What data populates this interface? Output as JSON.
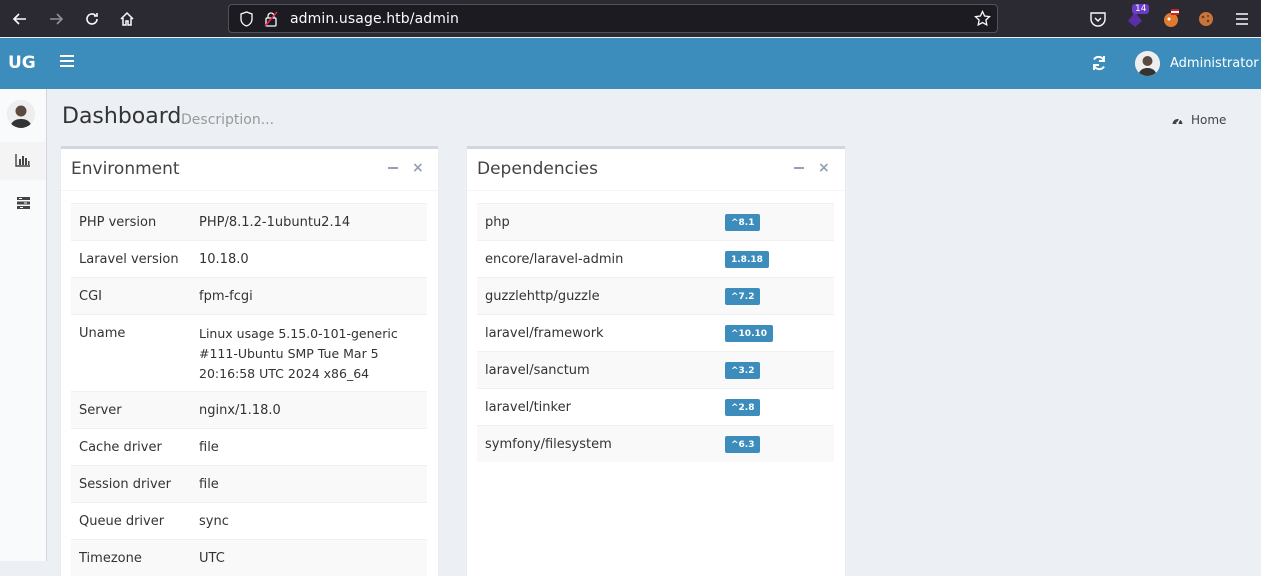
{
  "browser": {
    "url": "admin.usage.htb/admin",
    "notification_count": "14"
  },
  "header": {
    "logo": "UG",
    "user_name": "Administrator"
  },
  "content": {
    "title": "Dashboard",
    "description": "Description...",
    "breadcrumb_home": "Home"
  },
  "environment": {
    "title": "Environment",
    "rows": [
      {
        "key": "PHP version",
        "value": "PHP/8.1.2-1ubuntu2.14"
      },
      {
        "key": "Laravel version",
        "value": "10.18.0"
      },
      {
        "key": "CGI",
        "value": "fpm-fcgi"
      },
      {
        "key": "Uname",
        "value": "Linux usage 5.15.0-101-generic #111-Ubuntu SMP Tue Mar 5 20:16:58 UTC 2024 x86_64"
      },
      {
        "key": "Server",
        "value": "nginx/1.18.0"
      },
      {
        "key": "Cache driver",
        "value": "file"
      },
      {
        "key": "Session driver",
        "value": "file"
      },
      {
        "key": "Queue driver",
        "value": "sync"
      },
      {
        "key": "Timezone",
        "value": "UTC"
      }
    ]
  },
  "dependencies": {
    "title": "Dependencies",
    "rows": [
      {
        "name": "php",
        "version": "^8.1"
      },
      {
        "name": "encore/laravel-admin",
        "version": "1.8.18"
      },
      {
        "name": "guzzlehttp/guzzle",
        "version": "^7.2"
      },
      {
        "name": "laravel/framework",
        "version": "^10.10"
      },
      {
        "name": "laravel/sanctum",
        "version": "^3.2"
      },
      {
        "name": "laravel/tinker",
        "version": "^2.8"
      },
      {
        "name": "symfony/filesystem",
        "version": "^6.3"
      }
    ]
  },
  "colors": {
    "header_bg": "#3c8dbc",
    "badge_bg": "#3c8dbc",
    "page_bg": "#ecf0f5"
  }
}
